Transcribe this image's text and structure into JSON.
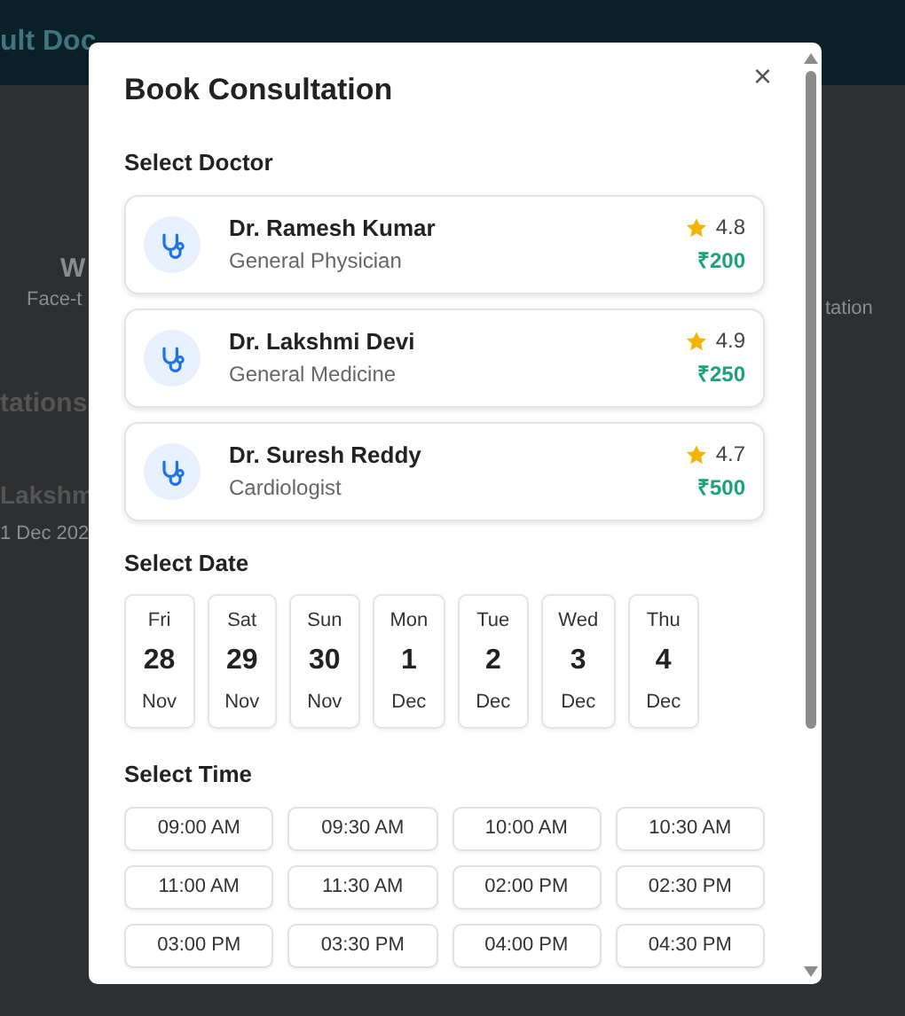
{
  "background": {
    "header_title": "ult Doc",
    "left_texts": [
      "W",
      "Face-t"
    ],
    "right_text": "tation",
    "section_title": "tations",
    "item_name": "Lakshm",
    "item_date": "1 Dec 202"
  },
  "modal": {
    "title": "Book Consultation",
    "close": "×",
    "doctor_heading": "Select Doctor",
    "doctors": [
      {
        "name": "Dr. Ramesh Kumar",
        "specialty": "General Physician",
        "rating": "4.8",
        "fee": "₹200",
        "selected": false
      },
      {
        "name": "Dr. Lakshmi Devi",
        "specialty": "General Medicine",
        "rating": "4.9",
        "fee": "₹250",
        "selected": false
      },
      {
        "name": "Dr. Suresh Reddy",
        "specialty": "Cardiologist",
        "rating": "4.7",
        "fee": "₹500",
        "selected": false
      }
    ],
    "date_heading": "Select Date",
    "dates": [
      {
        "weekday": "Fri",
        "day": "28",
        "month": "Nov",
        "selected": false
      },
      {
        "weekday": "Sat",
        "day": "29",
        "month": "Nov",
        "selected": false
      },
      {
        "weekday": "Sun",
        "day": "30",
        "month": "Nov",
        "selected": false
      },
      {
        "weekday": "Mon",
        "day": "1",
        "month": "Dec",
        "selected": false
      },
      {
        "weekday": "Tue",
        "day": "2",
        "month": "Dec",
        "selected": false
      },
      {
        "weekday": "Wed",
        "day": "3",
        "month": "Dec",
        "selected": false
      },
      {
        "weekday": "Thu",
        "day": "4",
        "month": "Dec",
        "selected": false
      }
    ],
    "time_heading": "Select Time",
    "times": [
      {
        "label": "09:00 AM",
        "selected": false
      },
      {
        "label": "09:30 AM",
        "selected": false
      },
      {
        "label": "10:00 AM",
        "selected": false
      },
      {
        "label": "10:30 AM",
        "selected": false
      },
      {
        "label": "11:00 AM",
        "selected": false
      },
      {
        "label": "11:30 AM",
        "selected": false
      },
      {
        "label": "02:00 PM",
        "selected": false
      },
      {
        "label": "02:30 PM",
        "selected": false
      },
      {
        "label": "03:00 PM",
        "selected": false
      },
      {
        "label": "03:30 PM",
        "selected": false
      },
      {
        "label": "04:00 PM",
        "selected": false
      },
      {
        "label": "04:30 PM",
        "selected": false
      }
    ]
  }
}
